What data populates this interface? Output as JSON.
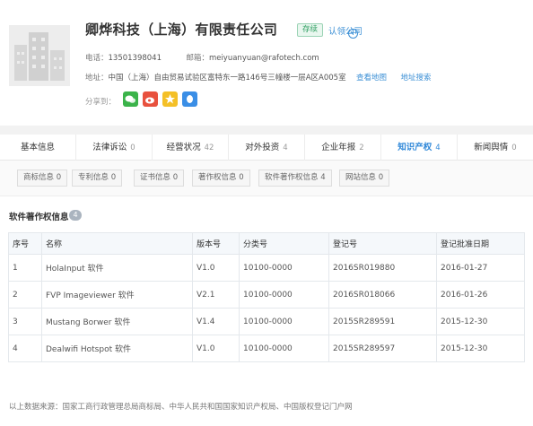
{
  "company": {
    "name": "卿烨科技（上海）有限责任公司",
    "status": "存续",
    "claim_label": "认领公司",
    "phone_label": "电话：",
    "phone": "13501398041",
    "email_label": "邮箱：",
    "email": "meiyuanyuan@rafotech.com",
    "address_label": "地址：",
    "address": "中国（上海）自由贸易试验区富特东一路146号三幢楼一层A区A005室",
    "view_map": "查看地图",
    "address_search": "地址搜索",
    "share_label": "分享到："
  },
  "share": [
    {
      "icon": "wechat-icon",
      "color": "#3bb34a"
    },
    {
      "icon": "weibo-icon",
      "color": "#e8513e"
    },
    {
      "icon": "star-icon",
      "color": "#f4c027"
    },
    {
      "icon": "qq-icon",
      "color": "#3a8ee6"
    }
  ],
  "tabs": [
    {
      "label": "基本信息",
      "count": ""
    },
    {
      "label": "法律诉讼",
      "count": "0"
    },
    {
      "label": "经营状况",
      "count": "42"
    },
    {
      "label": "对外投资",
      "count": "4"
    },
    {
      "label": "企业年报",
      "count": "2"
    },
    {
      "label": "知识产权",
      "count": "4"
    },
    {
      "label": "新闻舆情",
      "count": "0"
    }
  ],
  "subtabs": [
    "商标信息 0",
    "专利信息 0",
    "证书信息 0",
    "著作权信息 0",
    "软件著作权信息 4",
    "网站信息 0"
  ],
  "section": {
    "title": "软件著作权信息",
    "count": "4"
  },
  "table": {
    "headers": [
      "序号",
      "名称",
      "版本号",
      "分类号",
      "登记号",
      "登记批准日期"
    ],
    "rows": [
      [
        "1",
        "HolaInput 软件",
        "V1.0",
        "10100-0000",
        "2016SR019880",
        "2016-01-27"
      ],
      [
        "2",
        "FVP Imageviewer 软件",
        "V2.1",
        "10100-0000",
        "2016SR018066",
        "2016-01-26"
      ],
      [
        "3",
        "Mustang Borwer 软件",
        "V1.4",
        "10100-0000",
        "2015SR289591",
        "2015-12-30"
      ],
      [
        "4",
        "Dealwifi Hotspot 软件",
        "V1.0",
        "10100-0000",
        "2015SR289597",
        "2015-12-30"
      ]
    ]
  },
  "footnote": "以上数据来源：国家工商行政管理总局商标局、中华人民共和国国家知识产权局、中国版权登记门户网",
  "colors": {
    "accent": "#2e87d8",
    "status_green": "#2c9d5f"
  }
}
